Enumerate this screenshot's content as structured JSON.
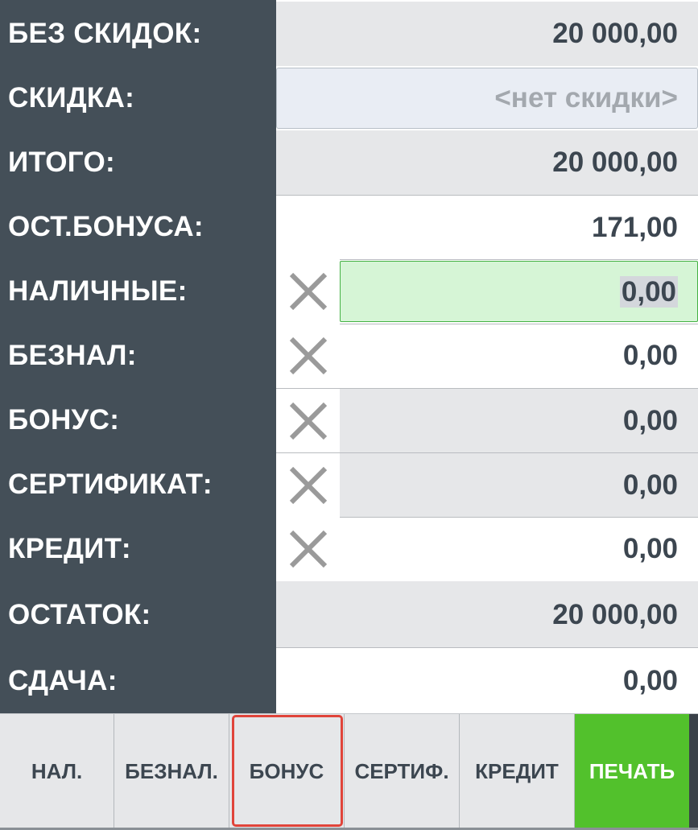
{
  "rows": {
    "subtotal": {
      "label": "БЕЗ СКИДОК:",
      "value": "20 000,00"
    },
    "discount": {
      "label": "СКИДКА:",
      "placeholder": "<нет скидки>"
    },
    "total": {
      "label": "ИТОГО:",
      "value": "20 000,00"
    },
    "bonus_left": {
      "label": "ОСТ.БОНУСА:",
      "value": "171,00"
    },
    "cash": {
      "label": "НАЛИЧНЫЕ:",
      "value": "0,00"
    },
    "noncash": {
      "label": "БЕЗНАЛ:",
      "value": "0,00"
    },
    "bonus": {
      "label": "БОНУС:",
      "value": "0,00"
    },
    "certificate": {
      "label": "СЕРТИФИКАТ:",
      "value": "0,00"
    },
    "credit": {
      "label": "КРЕДИТ:",
      "value": "0,00"
    },
    "remainder": {
      "label": "ОСТАТОК:",
      "value": "20 000,00"
    },
    "change": {
      "label": "СДАЧА:",
      "value": "0,00"
    }
  },
  "tabs": {
    "cash": "НАЛ.",
    "noncash": "БЕЗНАЛ.",
    "bonus": "БОНУС",
    "certificate": "СЕРТИФ.",
    "credit": "КРЕДИТ",
    "print": "ПЕЧАТЬ"
  },
  "selected_tab": "bonus",
  "active_field": "cash",
  "icons": {
    "clear": "close-icon"
  },
  "colors": {
    "label_panel": "#444f58",
    "active_field_bg": "#d6f5d6",
    "active_field_border": "#44b244",
    "print_button": "#52c12c",
    "selected_tab_border": "#e0443a"
  }
}
